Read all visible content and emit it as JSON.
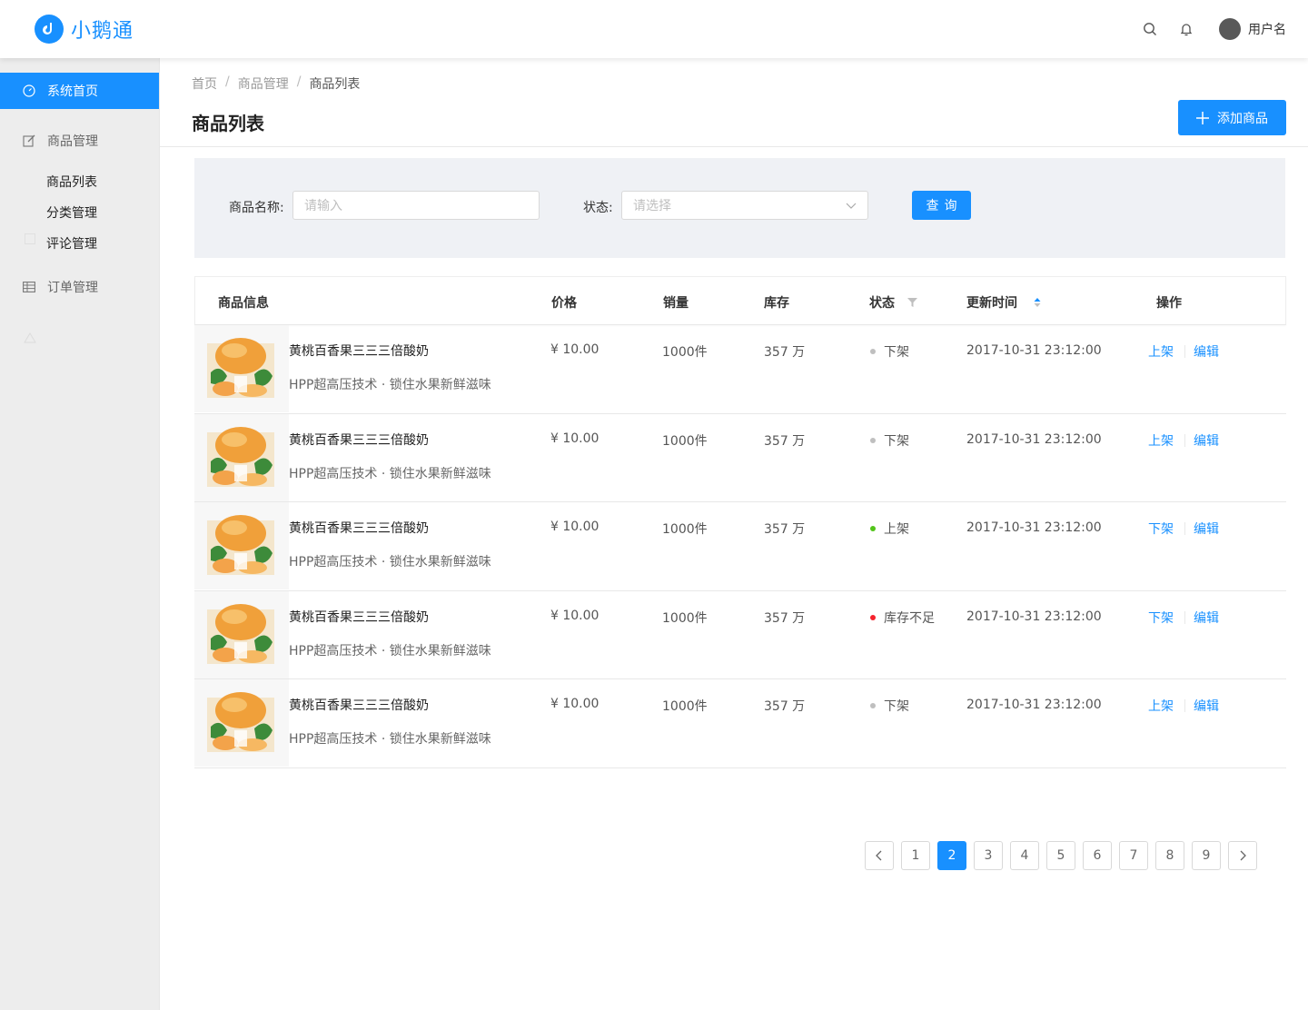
{
  "app": {
    "name": "小鹅通"
  },
  "header": {
    "username": "用户名"
  },
  "sidebar": {
    "active": "系统首页",
    "items": [
      {
        "label": "商品管理"
      },
      {
        "label": "订单管理"
      }
    ],
    "subitems": [
      "商品列表",
      "分类管理",
      "评论管理"
    ]
  },
  "breadcrumb": [
    "首页",
    "商品管理",
    "商品列表"
  ],
  "page": {
    "title": "商品列表",
    "add_label": "添加商品"
  },
  "search": {
    "name_label": "商品名称:",
    "name_placeholder": "请输入",
    "status_label": "状态:",
    "status_placeholder": "请选择",
    "query_label": "查询"
  },
  "table": {
    "columns": [
      "商品信息",
      "价格",
      "销量",
      "库存",
      "状态",
      "更新时间",
      "操作"
    ],
    "rows": [
      {
        "name": "黄桃百香果三三三倍酸奶",
        "desc": "HPP超高压技术 · 锁住水果新鲜滋味",
        "price": "¥ 10.00",
        "sales": "1000件",
        "stock": "357 万",
        "status": "下架",
        "status_color": "#bfbfbf",
        "updated": "2017-10-31  23:12:00",
        "action1": "上架",
        "action2": "编辑"
      },
      {
        "name": "黄桃百香果三三三倍酸奶",
        "desc": "HPP超高压技术 · 锁住水果新鲜滋味",
        "price": "¥ 10.00",
        "sales": "1000件",
        "stock": "357 万",
        "status": "下架",
        "status_color": "#bfbfbf",
        "updated": "2017-10-31  23:12:00",
        "action1": "上架",
        "action2": "编辑"
      },
      {
        "name": "黄桃百香果三三三倍酸奶",
        "desc": "HPP超高压技术 · 锁住水果新鲜滋味",
        "price": "¥ 10.00",
        "sales": "1000件",
        "stock": "357 万",
        "status": "上架",
        "status_color": "#52c41a",
        "updated": "2017-10-31  23:12:00",
        "action1": "下架",
        "action2": "编辑"
      },
      {
        "name": "黄桃百香果三三三倍酸奶",
        "desc": "HPP超高压技术 · 锁住水果新鲜滋味",
        "price": "¥ 10.00",
        "sales": "1000件",
        "stock": "357 万",
        "status": "库存不足",
        "status_color": "#f5222d",
        "updated": "2017-10-31  23:12:00",
        "action1": "下架",
        "action2": "编辑"
      },
      {
        "name": "黄桃百香果三三三倍酸奶",
        "desc": "HPP超高压技术 · 锁住水果新鲜滋味",
        "price": "¥ 10.00",
        "sales": "1000件",
        "stock": "357 万",
        "status": "下架",
        "status_color": "#bfbfbf",
        "updated": "2017-10-31  23:12:00",
        "action1": "上架",
        "action2": "编辑"
      }
    ]
  },
  "pagination": {
    "pages": [
      "1",
      "2",
      "3",
      "4",
      "5",
      "6",
      "7",
      "8",
      "9"
    ],
    "current": "2"
  },
  "colors": {
    "primary": "#1890ff",
    "sidebar_bg": "#ededed",
    "panel_bg": "#eff1f5"
  }
}
